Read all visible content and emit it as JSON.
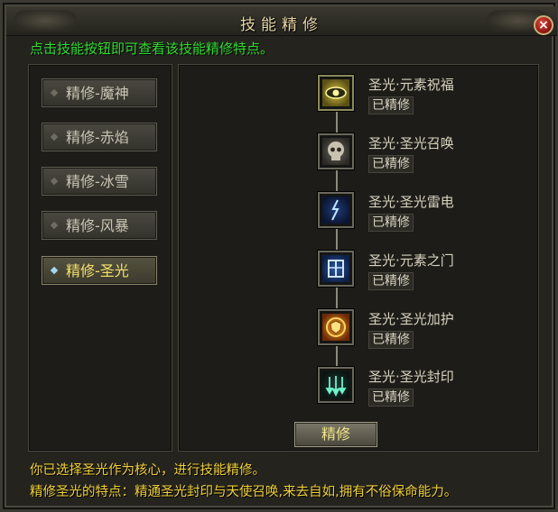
{
  "window": {
    "title": "技能精修",
    "close_label": "×"
  },
  "hint": "点击技能按钮即可查看该技能精修特点。",
  "tabs": [
    {
      "label": "精修-魔神",
      "active": false
    },
    {
      "label": "精修-赤焰",
      "active": false
    },
    {
      "label": "精修-冰雪",
      "active": false
    },
    {
      "label": "精修-风暴",
      "active": false
    },
    {
      "label": "精修-圣光",
      "active": true
    }
  ],
  "skills": [
    {
      "name": "圣光·元素祝福",
      "status": "已精修",
      "icon": "eye-icon"
    },
    {
      "name": "圣光·圣光召唤",
      "status": "已精修",
      "icon": "skull-icon"
    },
    {
      "name": "圣光·圣光雷电",
      "status": "已精修",
      "icon": "lightning-icon"
    },
    {
      "name": "圣光·元素之门",
      "status": "已精修",
      "icon": "gate-icon"
    },
    {
      "name": "圣光·圣光加护",
      "status": "已精修",
      "icon": "shield-sun-icon"
    },
    {
      "name": "圣光·圣光封印",
      "status": "已精修",
      "icon": "arrows-down-icon"
    }
  ],
  "refine_button": "精修",
  "description": {
    "line1": "你已选择圣光作为核心，进行技能精修。",
    "line2": "精修圣光的特点：精通圣光封印与天使召唤,来去自如,拥有不俗保命能力。"
  },
  "colors": {
    "hint": "#33dd33",
    "desc": "#f2d23a",
    "active_tab": "#f5e06a"
  }
}
